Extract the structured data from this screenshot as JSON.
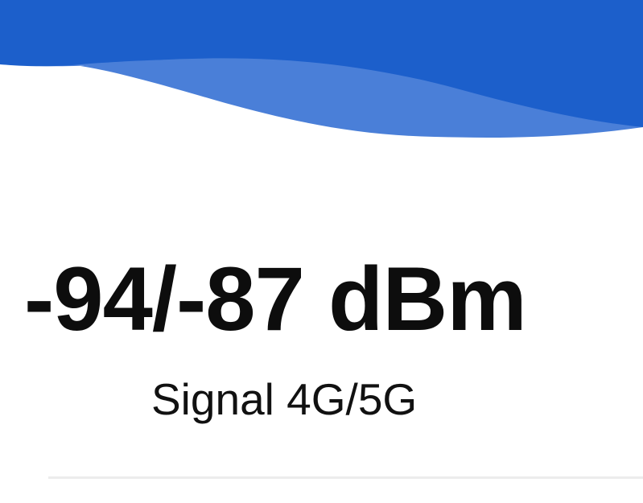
{
  "signal": {
    "value": "-94/-87 dBm",
    "label": "Signal 4G/5G"
  },
  "colors": {
    "header_dark": "#1c5fcb",
    "header_light": "#4a7fd8",
    "text": "#0d0d0d",
    "divider": "#ececec"
  }
}
